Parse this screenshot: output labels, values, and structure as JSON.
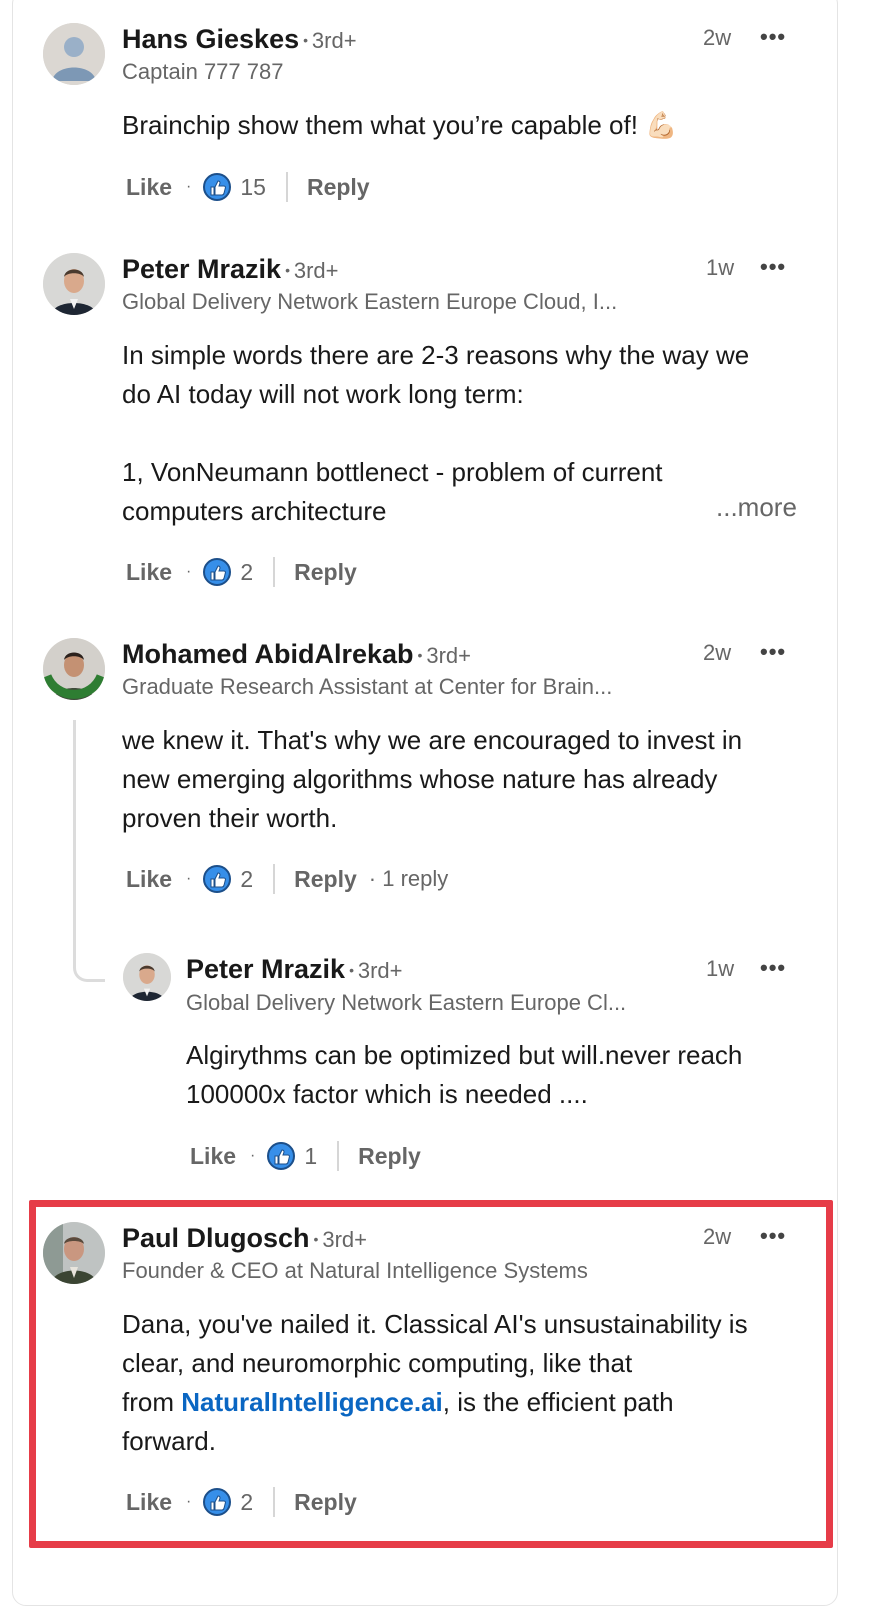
{
  "comments": [
    {
      "name": "Hans Gieskes",
      "degree": "3rd+",
      "headline": "Captain 777 787",
      "time": "2w",
      "more": "•••",
      "body": "Brainchip show them what you’re capable of! 💪🏻",
      "like_label": "Like",
      "likes": "15",
      "reply_label": "Reply"
    },
    {
      "name": "Peter Mrazik",
      "degree": "3rd+",
      "headline": "Global Delivery Network Eastern Europe Cloud, I...",
      "time": "1w",
      "more": "•••",
      "body_lines": [
        "In simple words there are 2-3 reasons why the way we",
        "do AI today will not work long term:",
        "",
        "1, VonNeumann bottlenect - problem of current",
        "computers architecture"
      ],
      "see_more": "...more",
      "like_label": "Like",
      "likes": "2",
      "reply_label": "Reply"
    },
    {
      "name": "Mohamed AbidAlrekab",
      "degree": "3rd+",
      "headline": "Graduate Research Assistant at Center for Brain...",
      "time": "2w",
      "more": "•••",
      "body_lines": [
        "we knew it. That's why we are encouraged to invest in",
        "new emerging algorithms whose nature has already",
        "proven their worth."
      ],
      "like_label": "Like",
      "likes": "2",
      "reply_label": "Reply",
      "replies": "· 1 reply",
      "avatar_badge": "#OPENTOWORK"
    },
    {
      "name": "Peter Mrazik",
      "degree": "3rd+",
      "headline": "Global Delivery Network Eastern Europe Cl...",
      "time": "1w",
      "more": "•••",
      "body_lines": [
        "Algirythms can be optimized but will.never reach",
        "100000x factor which is needed ...."
      ],
      "like_label": "Like",
      "likes": "1",
      "reply_label": "Reply"
    },
    {
      "name": "Paul Dlugosch",
      "degree": "3rd+",
      "headline": "Founder & CEO at Natural Intelligence Systems",
      "time": "2w",
      "more": "•••",
      "body_line1": "Dana, you've nailed it. Classical AI's unsustainability is",
      "body_line2": "clear, and neuromorphic computing, like that",
      "body_line3_pre": "from ",
      "body_link": "NaturalIntelligence.ai",
      "body_line3_post": ", is the efficient path",
      "body_line4": "forward.",
      "like_label": "Like",
      "likes": "2",
      "reply_label": "Reply"
    }
  ],
  "colors": {
    "link": "#0a66c2",
    "highlight_border": "#e63c48",
    "like_blue": "#378fe9",
    "open_to_work": "#2e7d32"
  },
  "icons": [
    "thumbs-up-icon",
    "more-options-icon",
    "avatar-placeholder-icon"
  ]
}
